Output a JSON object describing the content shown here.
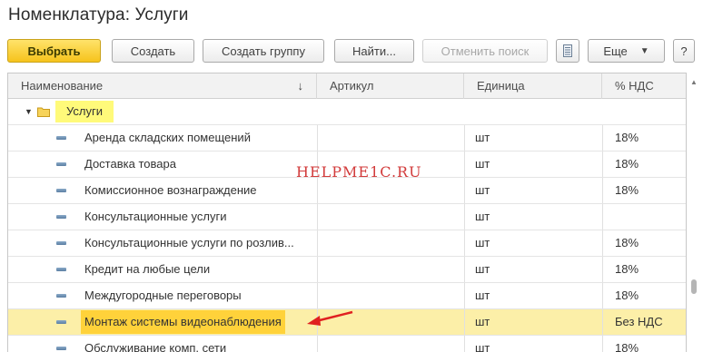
{
  "title": "Номенклатура: Услуги",
  "toolbar": {
    "choose": "Выбрать",
    "create": "Создать",
    "create_group": "Создать группу",
    "find": "Найти...",
    "cancel_search": "Отменить поиск",
    "more": "Еще",
    "help": "?"
  },
  "table": {
    "headers": [
      "Наименование",
      "Артикул",
      "Единица",
      "% НДС"
    ],
    "sort_indicator": "↓",
    "group": {
      "label": "Услуги"
    },
    "rows": [
      {
        "name": "Аренда складских помещений",
        "article": "",
        "unit": "шт",
        "vat": "18%"
      },
      {
        "name": "Доставка товара",
        "article": "",
        "unit": "шт",
        "vat": "18%"
      },
      {
        "name": "Комиссионное вознаграждение",
        "article": "",
        "unit": "шт",
        "vat": "18%"
      },
      {
        "name": "Консультационные услуги",
        "article": "",
        "unit": "шт",
        "vat": ""
      },
      {
        "name": "Консультационные услуги по розлив...",
        "article": "",
        "unit": "шт",
        "vat": "18%"
      },
      {
        "name": "Кредит на любые цели",
        "article": "",
        "unit": "шт",
        "vat": "18%"
      },
      {
        "name": "Междугородные переговоры",
        "article": "",
        "unit": "шт",
        "vat": "18%"
      },
      {
        "name": "Монтаж системы видеонаблюдения",
        "article": "",
        "unit": "шт",
        "vat": "Без НДС",
        "selected": true
      },
      {
        "name": "Обслуживание комп. сети",
        "article": "",
        "unit": "шт",
        "vat": "18%"
      }
    ]
  },
  "watermark": "HELPME1C.RU",
  "colors": {
    "primary_button": "#f6c31c",
    "selected_row": "#fcefa8",
    "group_highlight": "#fffa7a",
    "arrow": "#e02020"
  }
}
